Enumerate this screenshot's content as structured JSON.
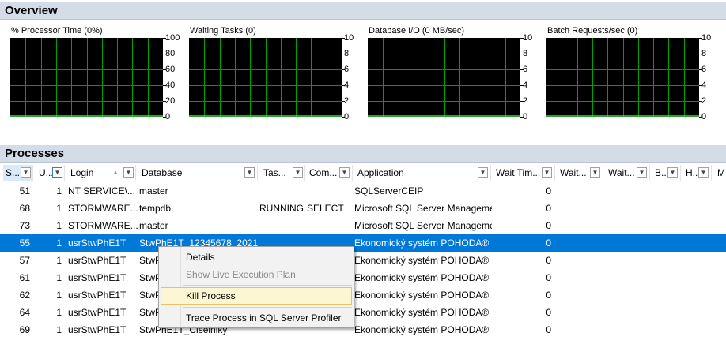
{
  "overview": {
    "title": "Overview"
  },
  "charts": [
    {
      "title": "% Processor Time (0%)",
      "ticks": [
        "100",
        "80",
        "60",
        "40",
        "20",
        "0"
      ]
    },
    {
      "title": "Waiting Tasks (0)",
      "ticks": [
        "10",
        "8",
        "6",
        "4",
        "2",
        "0"
      ]
    },
    {
      "title": "Database I/O (0 MB/sec)",
      "ticks": [
        "10",
        "8",
        "6",
        "4",
        "2",
        "0"
      ]
    },
    {
      "title": "Batch Requests/sec (0)",
      "ticks": [
        "10",
        "8",
        "6",
        "4",
        "2",
        "0"
      ]
    }
  ],
  "chart_data": [
    {
      "type": "line",
      "title": "% Processor Time (0%)",
      "ylim": [
        0,
        100
      ],
      "grid": true,
      "series": [
        {
          "values": [
            0,
            0,
            0,
            0,
            0
          ]
        }
      ]
    },
    {
      "type": "line",
      "title": "Waiting Tasks (0)",
      "ylim": [
        0,
        10
      ],
      "grid": true,
      "series": [
        {
          "values": [
            0,
            0,
            0,
            0,
            0
          ]
        }
      ]
    },
    {
      "type": "line",
      "title": "Database I/O (0 MB/sec)",
      "ylim": [
        0,
        10
      ],
      "grid": true,
      "series": [
        {
          "values": [
            0,
            0,
            0,
            0,
            0
          ]
        }
      ]
    },
    {
      "type": "line",
      "title": "Batch Requests/sec (0)",
      "ylim": [
        0,
        10
      ],
      "grid": true,
      "series": [
        {
          "values": [
            0,
            0,
            0,
            0,
            0
          ]
        }
      ]
    }
  ],
  "processes": {
    "title": "Processes",
    "columns": [
      "S...",
      "U...",
      "Login",
      "Database",
      "Tas...",
      "Com...",
      "Application",
      "Wait Tim...",
      "Wait...",
      "Wait...",
      "B...",
      "H...",
      "M"
    ],
    "rows": [
      [
        "51",
        "1",
        "NT SERVICE\\...",
        "master",
        "",
        "",
        "SQLServerCEIP",
        "0"
      ],
      [
        "68",
        "1",
        "STORMWARE...",
        "tempdb",
        "RUNNING",
        "SELECT",
        "Microsoft SQL Server Manageme...",
        "0"
      ],
      [
        "73",
        "1",
        "STORMWARE...",
        "master",
        "",
        "",
        "Microsoft SQL Server Manageme...",
        "0"
      ],
      [
        "55",
        "1",
        "usrStwPhE1T",
        "StwPhE1T_12345678_2021",
        "",
        "",
        "Ekonomický systém POHODA®",
        "0"
      ],
      [
        "57",
        "1",
        "usrStwPhE1T",
        "StwPhE1T",
        "",
        "",
        "Ekonomický systém POHODA®",
        "0"
      ],
      [
        "61",
        "1",
        "usrStwPhE1T",
        "StwPhE1T",
        "",
        "",
        "Ekonomický systém POHODA®",
        "0"
      ],
      [
        "62",
        "1",
        "usrStwPhE1T",
        "StwPhE1T",
        "",
        "",
        "Ekonomický systém POHODA®",
        "0"
      ],
      [
        "64",
        "1",
        "usrStwPhE1T",
        "StwPhE1T",
        "",
        "",
        "Ekonomický systém POHODA®",
        "0"
      ],
      [
        "69",
        "1",
        "usrStwPhE1T",
        "StwPhE1T_Ciselniky",
        "",
        "",
        "Ekonomický systém POHODA®",
        "0"
      ]
    ],
    "selected_row": 3
  },
  "context_menu": {
    "details": "Details",
    "show_plan": "Show Live Execution Plan",
    "kill": "Kill Process",
    "trace": "Trace Process in SQL Server Profiler"
  },
  "colors": {
    "accent": "#0078d7",
    "grid": "#00a000",
    "header_band": "#d4dce8",
    "menu_hover": "#fcf6d2"
  }
}
